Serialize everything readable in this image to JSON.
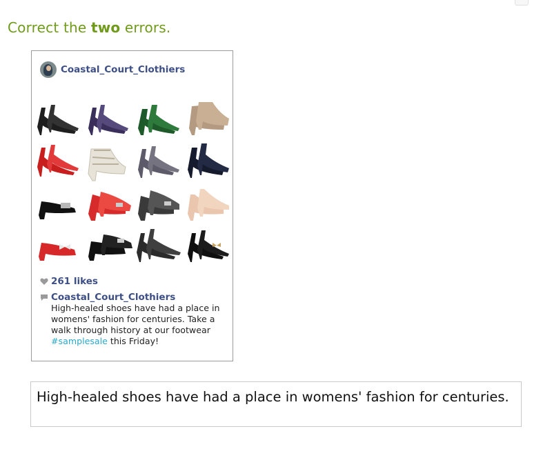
{
  "instruction": {
    "prefix": "Correct the ",
    "emphasis": "two",
    "suffix": " errors."
  },
  "post": {
    "username": "Coastal_Court_Clothiers",
    "likes": "261 likes",
    "caption_user": "Coastal_Court_Clothiers",
    "caption_text_before": "High-healed shoes have had a place in womens' fashion for centuries. Take a walk through history at our footwear ",
    "hashtag": "#samplesale",
    "caption_text_after": " this Friday!"
  },
  "answer": {
    "text": "High-healed shoes have had a place in womens' fashion for centuries."
  },
  "colors": {
    "instruction": "#6f9a1a",
    "username": "#3d4f86",
    "hashtag": "#2aa8c8"
  },
  "icons": [
    "heart-icon",
    "comment-icon",
    "avatar"
  ]
}
